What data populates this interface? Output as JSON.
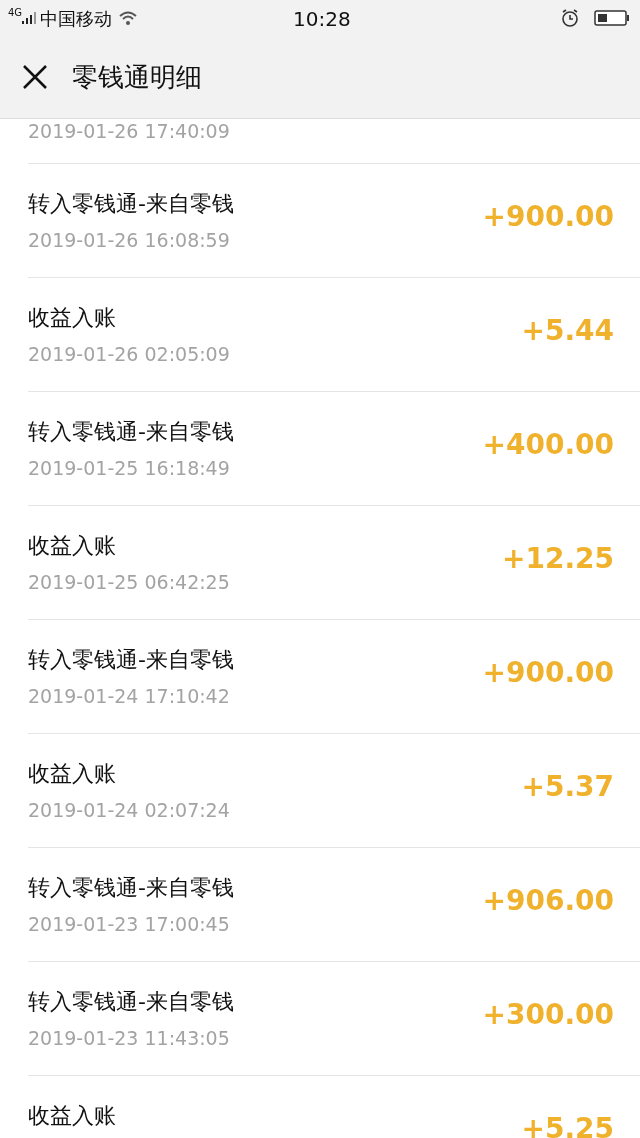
{
  "status_bar": {
    "network": "4G",
    "carrier": "中国移动",
    "time": "10:28"
  },
  "header": {
    "title": "零钱通明细"
  },
  "partial_row": {
    "time": "2019-01-26 17:40:09"
  },
  "rows": [
    {
      "title": "转入零钱通-来自零钱",
      "time": "2019-01-26 16:08:59",
      "amount": "+900.00"
    },
    {
      "title": "收益入账",
      "time": "2019-01-26 02:05:09",
      "amount": "+5.44"
    },
    {
      "title": "转入零钱通-来自零钱",
      "time": "2019-01-25 16:18:49",
      "amount": "+400.00"
    },
    {
      "title": "收益入账",
      "time": "2019-01-25 06:42:25",
      "amount": "+12.25"
    },
    {
      "title": "转入零钱通-来自零钱",
      "time": "2019-01-24 17:10:42",
      "amount": "+900.00"
    },
    {
      "title": "收益入账",
      "time": "2019-01-24 02:07:24",
      "amount": "+5.37"
    },
    {
      "title": "转入零钱通-来自零钱",
      "time": "2019-01-23 17:00:45",
      "amount": "+906.00"
    },
    {
      "title": "转入零钱通-来自零钱",
      "time": "2019-01-23 11:43:05",
      "amount": "+300.00"
    },
    {
      "title": "收益入账",
      "amount": "+5.25"
    }
  ]
}
